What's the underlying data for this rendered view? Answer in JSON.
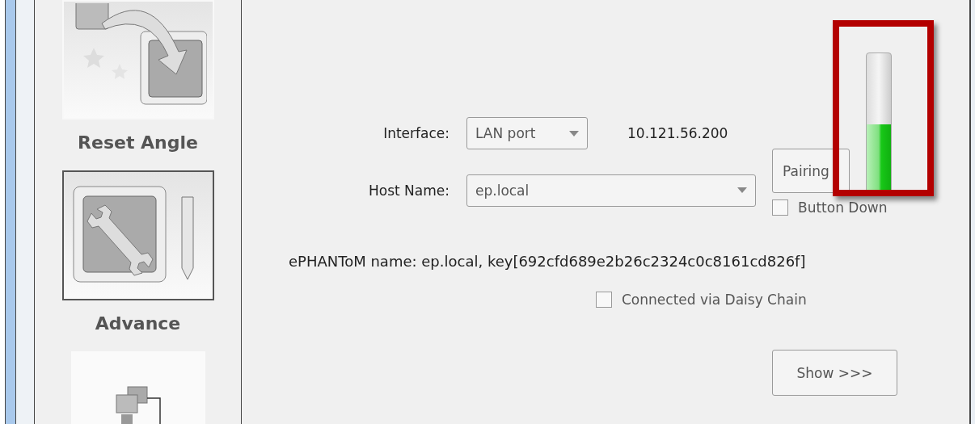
{
  "sidebar": {
    "items": [
      {
        "kind": "reset",
        "label": "Reset Angle",
        "selected": false
      },
      {
        "kind": "advance",
        "label": "Advance",
        "selected": true
      },
      {
        "kind": "network",
        "selected": false
      }
    ]
  },
  "connection": {
    "interface": {
      "label": "Interface:",
      "value": "LAN port"
    },
    "ip_address": "10.121.56.200",
    "host_name": {
      "label": "Host Name:",
      "value": "ep.local"
    },
    "pairing_button": "Pairing",
    "button_down": {
      "label": "Button Down",
      "checked": false
    },
    "signal_meter": {
      "level": 0.5
    },
    "info": "ePHANToM name: ep.local, key[692cfd689e2b26c2324c0c8161cd826f]",
    "daisy_chain": {
      "label": "Connected via Daisy Chain",
      "checked": false
    },
    "show_button": "Show >>>"
  }
}
